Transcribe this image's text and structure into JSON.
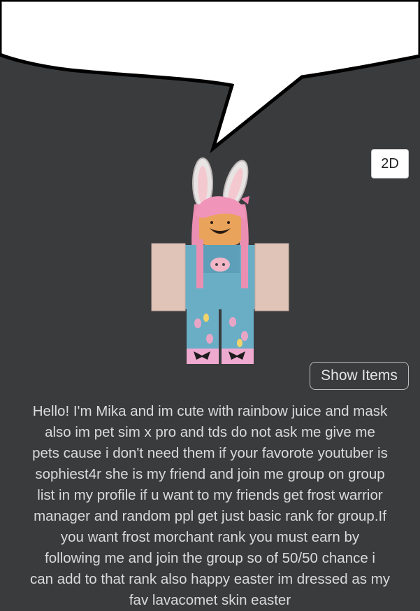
{
  "controls": {
    "view_toggle_label": "2D",
    "show_items_label": "Show Items"
  },
  "profile": {
    "description": "Hello! I'm Mika and im cute with rainbow juice and mask\nalso im pet sim x pro and tds do not ask me give me\npets cause i don't need them if your favorote youtuber is\nsophiest4r she is my friend and join me group  on group\nlist in my profile if u want to my friends get frost warrior\nmanager and random ppl get just basic rank for group.If\nyou want frost morchant rank you must earn by\nfollowing me and join the group so of 50/50 chance i\ncan add to that rank also happy easter im dressed as my\nfav lavacomet skin easter"
  },
  "icons": {
    "speech_bubble": "speech-bubble-icon",
    "avatar": "avatar-3d-figure"
  },
  "colors": {
    "background": "#393b3d",
    "bubble": "#ffffff",
    "text": "#dadada"
  }
}
